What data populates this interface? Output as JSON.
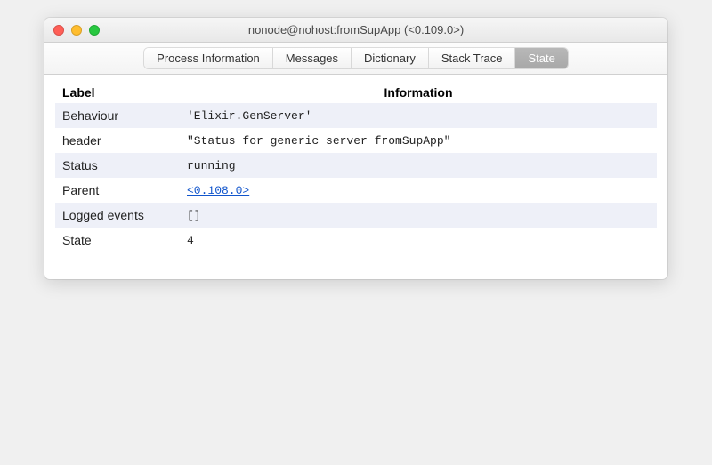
{
  "window": {
    "title": "nonode@nohost:fromSupApp (<0.109.0>)"
  },
  "tabs": {
    "items": [
      {
        "label": "Process Information",
        "active": false
      },
      {
        "label": "Messages",
        "active": false
      },
      {
        "label": "Dictionary",
        "active": false
      },
      {
        "label": "Stack Trace",
        "active": false
      },
      {
        "label": "State",
        "active": true
      }
    ]
  },
  "table": {
    "headers": {
      "label": "Label",
      "info": "Information"
    },
    "rows": [
      {
        "label": "Behaviour",
        "info": "'Elixir.GenServer'",
        "is_link": false
      },
      {
        "label": "header",
        "info": "\"Status for generic server fromSupApp\"",
        "is_link": false
      },
      {
        "label": "Status",
        "info": "running",
        "is_link": false
      },
      {
        "label": "Parent",
        "info": "<0.108.0>",
        "is_link": true
      },
      {
        "label": "Logged events",
        "info": "[]",
        "is_link": false
      },
      {
        "label": "State",
        "info": "4",
        "is_link": false
      }
    ]
  }
}
